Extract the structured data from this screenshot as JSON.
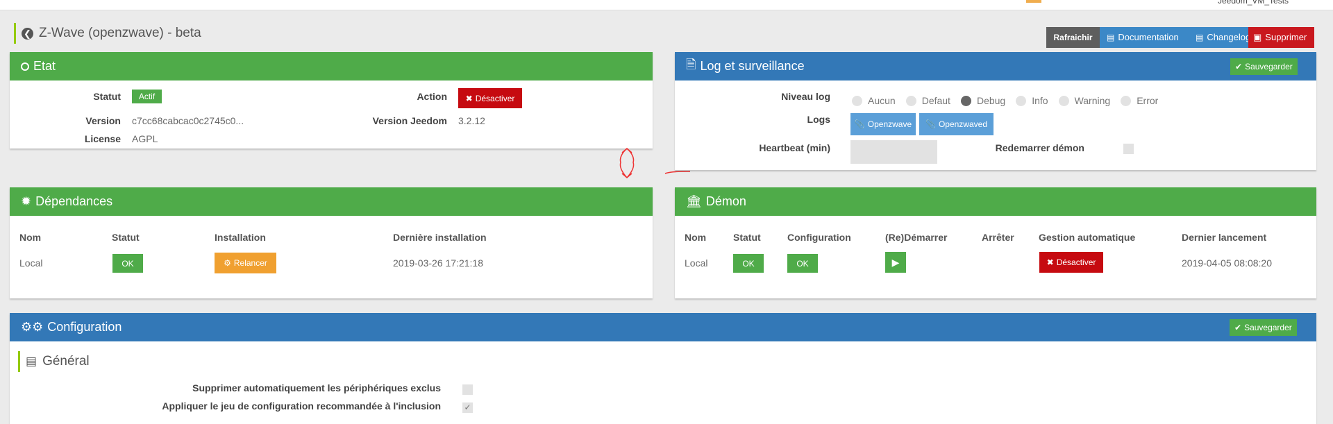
{
  "top": {
    "user": "Jeedom_VM_Tests"
  },
  "page": {
    "title": "Z-Wave (openzwave) - beta"
  },
  "toolbar": {
    "refresh": "Rafraichir",
    "documentation": "Documentation",
    "changelog": "Changelog",
    "delete": "Supprimer"
  },
  "etat": {
    "title": "Etat",
    "statut_label": "Statut",
    "statut_value": "Actif",
    "action_label": "Action",
    "action_button": "Désactiver",
    "version_label": "Version",
    "version_value": "c7cc68cabcac0c2745c0...",
    "version_jeedom_label": "Version Jeedom",
    "version_jeedom_value": "3.2.12",
    "license_label": "License",
    "license_value": "AGPL"
  },
  "log": {
    "title": "Log et surveillance",
    "save": "Sauvegarder",
    "niveau_label": "Niveau log",
    "levels": [
      "Aucun",
      "Defaut",
      "Debug",
      "Info",
      "Warning",
      "Error"
    ],
    "selected_level": "Debug",
    "logs_label": "Logs",
    "log_buttons": [
      "Openzwave",
      "Openzwaved"
    ],
    "heartbeat_label": "Heartbeat (min)",
    "heartbeat_value": "",
    "restart_label": "Redemarrer démon"
  },
  "dependances": {
    "title": "Dépendances",
    "headers": [
      "Nom",
      "Statut",
      "Installation",
      "Dernière installation"
    ],
    "row": {
      "nom": "Local",
      "statut": "OK",
      "installation": "Relancer",
      "derniere": "2019-03-26 17:21:18"
    }
  },
  "demon": {
    "title": "Démon",
    "headers": [
      "Nom",
      "Statut",
      "Configuration",
      "(Re)Démarrer",
      "Arrêter",
      "Gestion automatique",
      "Dernier lancement"
    ],
    "row": {
      "nom": "Local",
      "statut": "OK",
      "configuration": "OK",
      "gestion": "Désactiver",
      "dernier": "2019-04-05 08:08:20"
    }
  },
  "configuration": {
    "title": "Configuration",
    "save": "Sauvegarder",
    "section": "Général",
    "options": [
      {
        "label": "Supprimer automatiquement les périphériques exclus",
        "checked": false
      },
      {
        "label": "Appliquer le jeu de configuration recommandée à l'inclusion",
        "checked": true
      }
    ]
  },
  "colors": {
    "green": "#4fab49",
    "blue": "#3378b7",
    "red": "#c60a10",
    "orange": "#f0a030",
    "accent": "#94ca02"
  }
}
